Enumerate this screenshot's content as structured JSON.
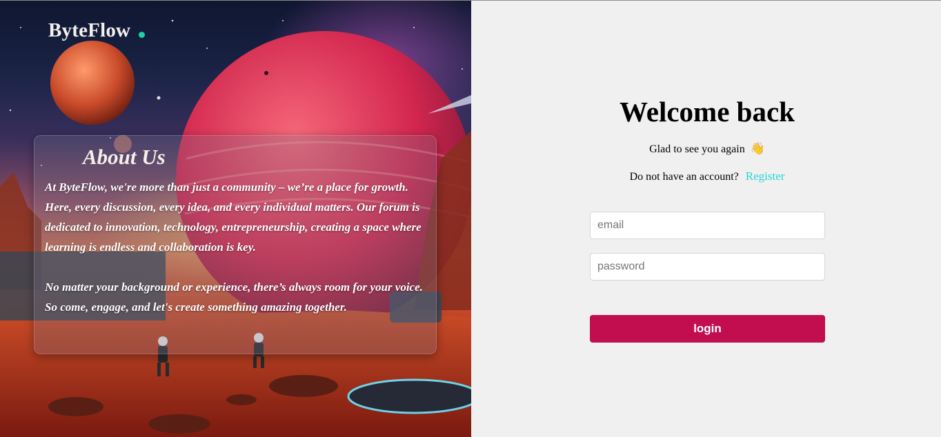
{
  "brand": {
    "name": "ByteFlow"
  },
  "about": {
    "title": "About Us",
    "paragraph_1": "At ByteFlow, we're more than just a community – we’re a place for growth. Here, every discussion, every idea, and every individual matters. Our forum is dedicated to innovation, technology, entrepreneurship, creating a space where learning is endless and collaboration is key.",
    "paragraph_2": "No matter your background or experience, there’s always room for your voice. So come, engage, and let's create something amazing together."
  },
  "login": {
    "heading": "Welcome back",
    "subtitle": "Glad to see you again",
    "subtitle_emoji": "👋",
    "register_prompt": "Do not have an account?",
    "register_link": "Register",
    "email_placeholder": "email",
    "password_placeholder": "password",
    "submit_label": "login"
  },
  "colors": {
    "accent_button": "#c20e4e",
    "register_link": "#23d5d5",
    "logo_dot": "#1ad3a4",
    "panel_background": "#f0f0f0"
  },
  "icons": {
    "logo_dot": "dot-icon",
    "greeting": "waving-hand-icon"
  }
}
